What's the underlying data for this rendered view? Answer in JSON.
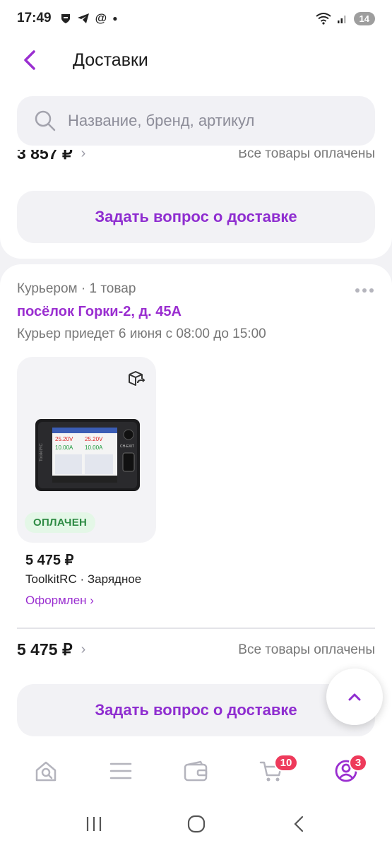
{
  "status_bar": {
    "time": "17:49",
    "battery": "14"
  },
  "header": {
    "title": "Доставки"
  },
  "search": {
    "placeholder": "Название, бренд, артикул"
  },
  "previous_order": {
    "total": "3 857 ₽",
    "payment_status": "Все товары оплачены",
    "ask_button": "Задать вопрос о доставке"
  },
  "delivery": {
    "method": "Курьером · 1 товар",
    "address": "посёлок Горки-2, д. 45А",
    "eta": "Курьер приедет 6 июня с 08:00 до 15:00",
    "item": {
      "badge": "ОПЛАЧЕН",
      "price": "5 475 ₽",
      "name": "ToolkitRC · Зарядное",
      "status": "Оформлен ›"
    },
    "total": "5 475 ₽",
    "payment_status": "Все товары оплачены",
    "ask_button": "Задать вопрос о доставке"
  },
  "product_screen": {
    "v1": "25.20V",
    "v2": "25.20V",
    "a1": "10.00A",
    "a2": "10.00A",
    "brand": "ToolkitRC",
    "button": "CH-EXIT"
  },
  "tabbar": {
    "cart_badge": "10",
    "profile_badge": "3"
  },
  "colors": {
    "accent": "#9a2ed0",
    "badge": "#ee3a5b",
    "paid": "#2e8b44"
  }
}
